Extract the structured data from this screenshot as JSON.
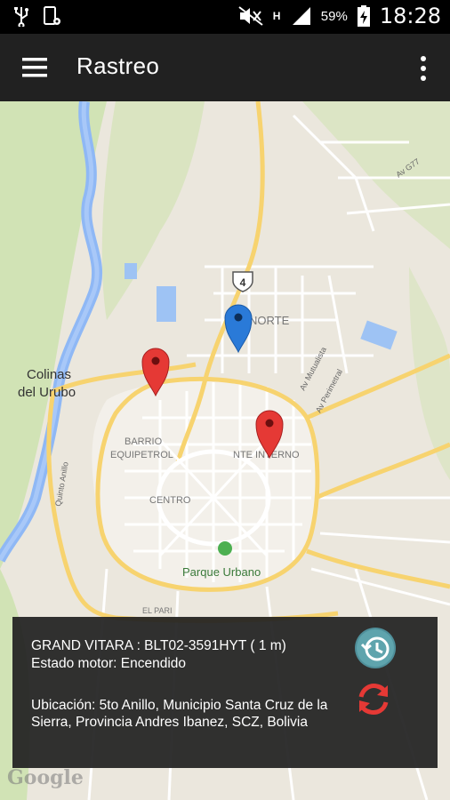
{
  "status_bar": {
    "battery_percent": "59%",
    "time": "18:28",
    "network": "H"
  },
  "app_bar": {
    "title": "Rastreo"
  },
  "map": {
    "labels": {
      "colinas_line1": "Colinas",
      "colinas_line2": "del Urubo",
      "norte": "NORTE",
      "barrio_line1": "BARRIO",
      "barrio_line2": "EQUIPETROL",
      "centro": "CENTRO",
      "nte_interno": "NTE INTERNO",
      "parque_urbano": "Parque Urbano",
      "road_4": "4",
      "av_mutualista": "Av Mutualista",
      "av_perimetral": "Av Perimetral",
      "av_g77": "Av G77",
      "quinto_anillo": "Quinto Anillo",
      "el_pari": "EL PARI"
    },
    "markers": [
      {
        "name": "blue-marker",
        "color": "#2a7ad8"
      },
      {
        "name": "red-marker-west",
        "color": "#e53935"
      },
      {
        "name": "red-marker-east",
        "color": "#e53935"
      }
    ],
    "attribution": "Google"
  },
  "info_panel": {
    "vehicle_line": "GRAND VITARA : BLT02-3591HYT ( 1 m)",
    "engine_line": "Estado motor: Encendido",
    "address_line": "Ubicación: 5to Anillo, Municipio Santa Cruz de la Sierra, Provincia Andres Ibanez, SCZ, Bolivia"
  }
}
